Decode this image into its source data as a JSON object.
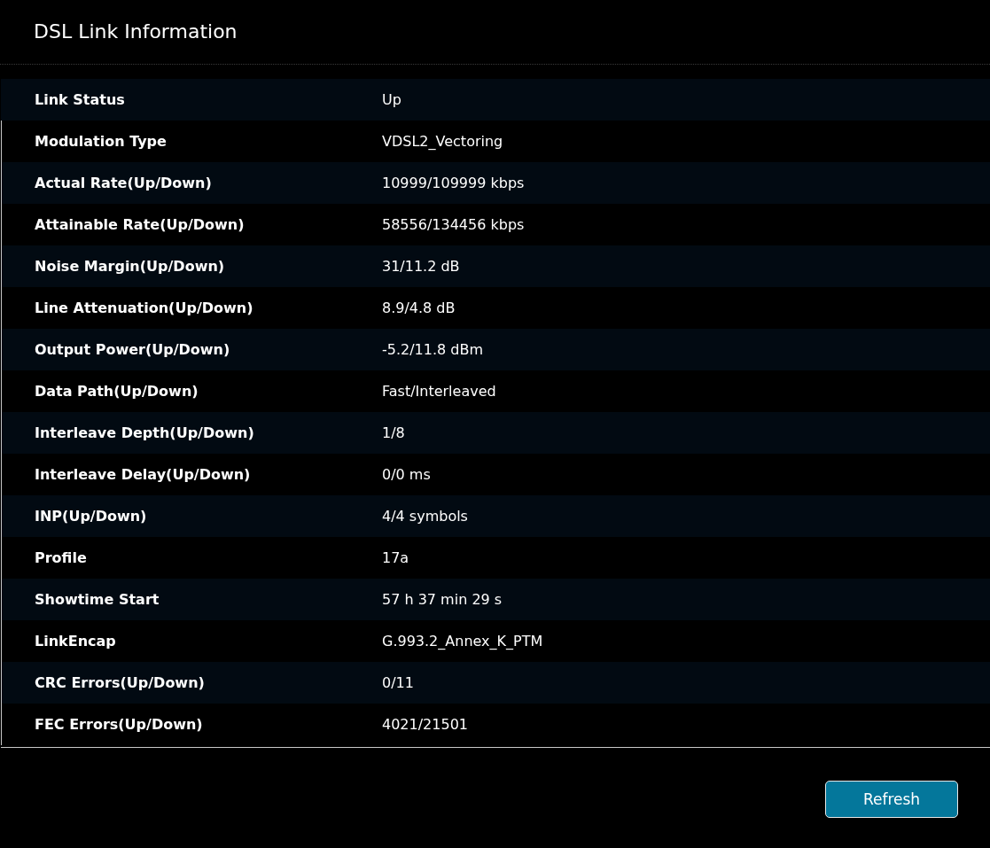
{
  "title": "DSL Link Information",
  "rows": [
    {
      "label": "Link Status",
      "value": "Up"
    },
    {
      "label": "Modulation Type",
      "value": "VDSL2_Vectoring"
    },
    {
      "label": "Actual Rate(Up/Down)",
      "value": "10999/109999 kbps"
    },
    {
      "label": "Attainable Rate(Up/Down)",
      "value": "58556/134456 kbps"
    },
    {
      "label": "Noise Margin(Up/Down)",
      "value": "31/11.2 dB"
    },
    {
      "label": "Line Attenuation(Up/Down)",
      "value": "8.9/4.8 dB"
    },
    {
      "label": "Output Power(Up/Down)",
      "value": "-5.2/11.8 dBm"
    },
    {
      "label": "Data Path(Up/Down)",
      "value": "Fast/Interleaved"
    },
    {
      "label": "Interleave Depth(Up/Down)",
      "value": "1/8"
    },
    {
      "label": "Interleave Delay(Up/Down)",
      "value": "0/0 ms"
    },
    {
      "label": "INP(Up/Down)",
      "value": "4/4 symbols"
    },
    {
      "label": "Profile",
      "value": "17a"
    },
    {
      "label": "Showtime Start",
      "value": "57 h 37 min 29 s"
    },
    {
      "label": "LinkEncap",
      "value": "G.993.2_Annex_K_PTM"
    },
    {
      "label": "CRC Errors(Up/Down)",
      "value": "0/11"
    },
    {
      "label": "FEC Errors(Up/Down)",
      "value": "4021/21501"
    }
  ],
  "buttons": [
    "Refresh"
  ]
}
